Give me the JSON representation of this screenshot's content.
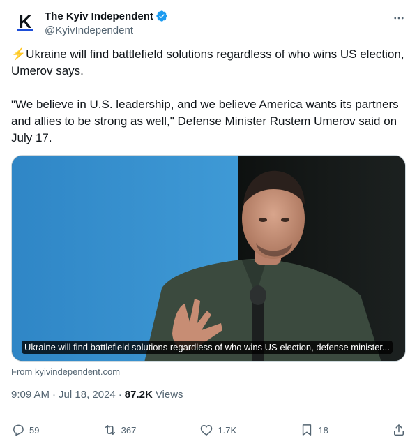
{
  "author": {
    "display_name": "The Kyiv Independent",
    "handle": "@KyivIndependent",
    "avatar_letter": "K",
    "verified": true
  },
  "tweet": {
    "bolt": "⚡",
    "text": "Ukraine will find battlefield solutions regardless of who wins US election, Umerov says.\n\n\"We believe in U.S. leadership, and we believe America wants its partners and allies to be strong as well,\" Defense Minister Rustem Umerov said on July 17."
  },
  "media": {
    "caption": "Ukraine will find battlefield solutions regardless of who wins US election, defense minister..."
  },
  "link_source": "From kyivindependent.com",
  "meta": {
    "time": "9:09 AM",
    "separator": "·",
    "date": "Jul 18, 2024",
    "views_count": "87.2K",
    "views_label": "Views"
  },
  "actions": {
    "replies": "59",
    "reposts": "367",
    "likes": "1.7K",
    "bookmarks": "18"
  },
  "colors": {
    "accent": "#1d9bf0",
    "text": "#0f1419",
    "secondary": "#536471"
  }
}
